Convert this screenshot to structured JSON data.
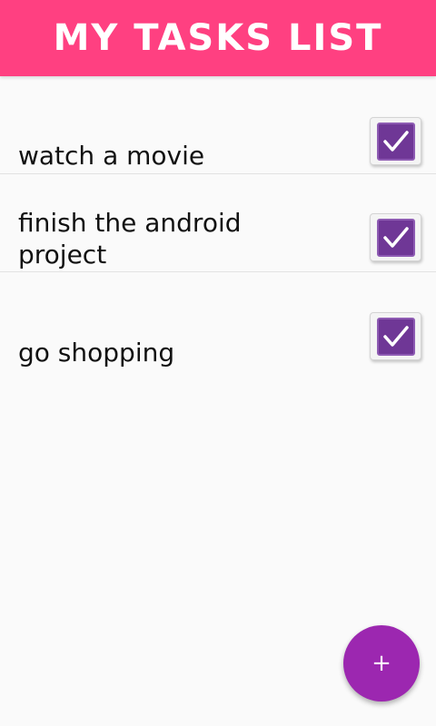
{
  "app_bar": {
    "title": "MY TASKS LIST"
  },
  "tasks": [
    {
      "text": "watch a movie",
      "checked": true
    },
    {
      "text": "finish the android project",
      "checked": true
    },
    {
      "text": "go shopping",
      "checked": true
    }
  ],
  "fab": {
    "label": "+",
    "icon": "plus-icon"
  },
  "colors": {
    "app_bar": "#ff4081",
    "fab": "#9c27b0",
    "checkbox_fill": "#6f3796",
    "background": "#fafafa"
  }
}
